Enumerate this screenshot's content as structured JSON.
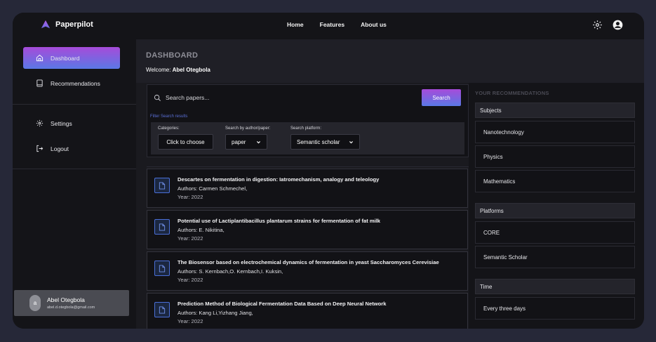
{
  "app": {
    "name": "Paperpilot"
  },
  "nav": {
    "home": "Home",
    "features": "Features",
    "about": "About us"
  },
  "sidebar": {
    "items": [
      {
        "label": "Dashboard",
        "icon": "home-icon",
        "active": true
      },
      {
        "label": "Recommendations",
        "icon": "book-icon",
        "active": false
      },
      {
        "label": "Settings",
        "icon": "gear-icon",
        "active": false
      },
      {
        "label": "Logout",
        "icon": "logout-icon",
        "active": false
      }
    ],
    "user": {
      "initial": "a",
      "name": "Abel Otegbola",
      "email": "abel.d.otegbola@gmail.com"
    }
  },
  "header": {
    "title": "DASHBOARD",
    "welcome_prefix": "Welcome: ",
    "welcome_name": "Abel Otegbola"
  },
  "search": {
    "placeholder": "Search papers...",
    "button": "Search",
    "filter_label": "Filter Search results",
    "categories": {
      "label": "Categories:",
      "value": "Click to choose"
    },
    "by": {
      "label": "Search by author/paper:",
      "value": "paper"
    },
    "platform": {
      "label": "Search platform:",
      "value": "Semantic scholar"
    }
  },
  "results": [
    {
      "title": "Descartes on fermentation in digestion: Iatromechanism, analogy and teleology",
      "authors": "Authors: Carmen Schmechel,",
      "year": "Year: 2022"
    },
    {
      "title": "Potential use of Lactiplantibacillus plantarum strains for fermentation of fat milk",
      "authors": "Authors: E. Nikitina,",
      "year": "Year: 2022"
    },
    {
      "title": "The Biosensor based on electrochemical dynamics of fermentation in yeast Saccharomyces Cerevisiae",
      "authors": "Authors: S. Kernbach,O. Kernbach,I. Kuksin,",
      "year": "Year: 2022"
    },
    {
      "title": "Prediction Method of Biological Fermentation Data Based on Deep Neural Network",
      "authors": "Authors: Kang Li,Yizhang Jiang,",
      "year": "Year: 2022"
    }
  ],
  "recommendations": {
    "title": "YOUR RECOMMENDATIONS",
    "subjects": {
      "label": "Subjects",
      "items": [
        "Nanotechnology",
        "Physics",
        "Mathematics"
      ]
    },
    "platforms": {
      "label": "Platforms",
      "items": [
        "CORE",
        "Semantic Scholar"
      ]
    },
    "time": {
      "label": "Time",
      "items": [
        "Every three days"
      ]
    }
  },
  "colors": {
    "accent_start": "#a64bd9",
    "accent_end": "#5a78e6",
    "link": "#5a6fd6"
  }
}
